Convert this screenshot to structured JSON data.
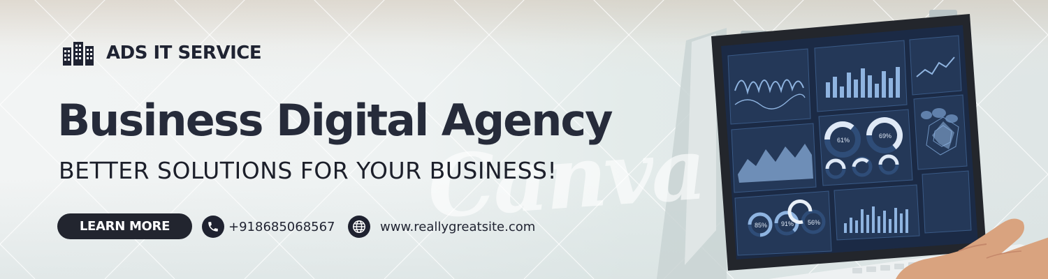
{
  "brand": {
    "name": "ADS IT SERVICE",
    "logo_icon": "buildings-logo-icon"
  },
  "hero": {
    "headline": "Business Digital Agency",
    "tagline": "BETTER SOLUTIONS FOR YOUR BUSINESS!"
  },
  "cta": {
    "label": "LEARN MORE"
  },
  "contact": {
    "phone": "+918685068567",
    "phone_icon": "phone-icon",
    "website": "www.reallygreatsite.com",
    "website_icon": "globe-icon"
  },
  "laptop_screen": {
    "gauges": [
      "61%",
      "69%",
      "85%",
      "91%",
      "56%"
    ]
  },
  "watermark": {
    "text": "Canva"
  },
  "colors": {
    "text_dark": "#262b3a",
    "button_bg": "#22252f",
    "button_text": "#ffffff",
    "background": "#eef2f2",
    "screen_bg": "#1b2a45",
    "chart_line": "#8fb4e0"
  }
}
